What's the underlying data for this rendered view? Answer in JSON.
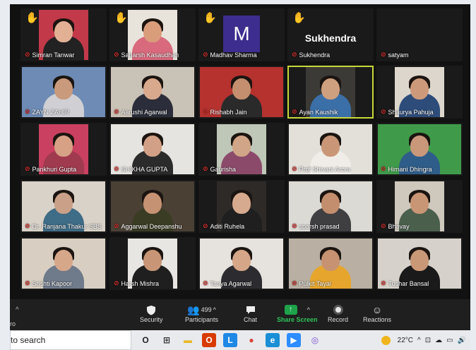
{
  "participants": [
    {
      "name": "Simran Tanwar",
      "hand": true,
      "bg": "#c23a4a",
      "skin": "#e2b095",
      "shirt": "#222"
    },
    {
      "name": "Saharsh Kasaudhan",
      "hand": true,
      "bg": "#e8e4dc",
      "skin": "#d99d7c",
      "shirt": "#d96a7d"
    },
    {
      "name": "Madhav Sharma",
      "hand": true,
      "avatar": "M"
    },
    {
      "name": "Sukhendra",
      "hand": true,
      "name_only": "Sukhendra"
    },
    {
      "name": "satyam",
      "hand": false,
      "empty": true
    },
    {
      "name": "ZAYN ZAHIR",
      "hand": false,
      "bg": "#6d8bb5",
      "skin": "#c99a7c",
      "shirt": "#cfcfd4",
      "full": true
    },
    {
      "name": "Aarushi Agarwal",
      "hand": false,
      "bg": "#c9c2b6",
      "skin": "#d8a98c",
      "shirt": "#2b2d3a",
      "full": true
    },
    {
      "name": "Rishabh Jain",
      "hand": false,
      "bg": "#b5322f",
      "skin": "#c48f6f",
      "shirt": "#2a2a2a",
      "full": true
    },
    {
      "name": "Ayan Kaushik",
      "hand": false,
      "bg": "#3c3a36",
      "skin": "#cfa07f",
      "shirt": "#3b6fa8",
      "active": true
    },
    {
      "name": "Shaurya Pahuja",
      "hand": false,
      "bg": "#dcd6cc",
      "skin": "#cc9a7a",
      "shirt": "#2d4c7a"
    },
    {
      "name": "Pankhuri Gupta",
      "hand": false,
      "bg": "#c94060",
      "skin": "#d6a185",
      "shirt": "#a03a4e"
    },
    {
      "name": "SHIKHA GUPTA",
      "hand": false,
      "bg": "#e6e4e0",
      "skin": "#d2a086",
      "shirt": "#2b2b2b",
      "full": true
    },
    {
      "name": "Gaurisha",
      "hand": false,
      "bg": "#bfc7b8",
      "skin": "#d1a587",
      "shirt": "#8c4a6a"
    },
    {
      "name": "Prof Shivani Arora",
      "hand": false,
      "bg": "#e3e0da",
      "skin": "#c99778",
      "shirt": "#f0ede8",
      "full": true
    },
    {
      "name": "Himani Dhingra",
      "hand": false,
      "bg": "#3f9b4a",
      "skin": "#c9987a",
      "shirt": "#2f5d8a",
      "full": true
    },
    {
      "name": "Dr. Ranjana Thakur SBS",
      "hand": false,
      "bg": "#d9d2c8",
      "skin": "#caa088",
      "shirt": "#3f6c86",
      "full": true
    },
    {
      "name": "Aggarwal Deepanshu",
      "hand": false,
      "bg": "#4a4034",
      "skin": "#c59273",
      "shirt": "#3a3c24",
      "full": true
    },
    {
      "name": "Aditi Ruhela",
      "hand": false,
      "bg": "#2e2a28",
      "skin": "#d6aa8e",
      "shirt": "#1f1f1f"
    },
    {
      "name": "sparsh prasad",
      "hand": false,
      "bg": "#dcdad5",
      "skin": "#c38e6d",
      "shirt": "#3f3f42",
      "full": true
    },
    {
      "name": "Bhavay",
      "hand": false,
      "bg": "#cfc8bd",
      "skin": "#c99675",
      "shirt": "#4b5f4d"
    },
    {
      "name": "Srishti Kapoor",
      "hand": false,
      "bg": "#d8cfc2",
      "skin": "#d7a78a",
      "shirt": "#6f7a8a",
      "full": true
    },
    {
      "name": "Harsh Mishra",
      "hand": false,
      "bg": "#e8e6e2",
      "skin": "#c89676",
      "shirt": "#1f1f1f"
    },
    {
      "name": "Tanya Agarwal",
      "hand": false,
      "bg": "#e6e2dd",
      "skin": "#d5a688",
      "shirt": "#2c2c30",
      "full": true
    },
    {
      "name": "Pulkit Tayal",
      "hand": false,
      "bg": "#b9b0a3",
      "skin": "#c79271",
      "shirt": "#e6a52c",
      "full": true
    },
    {
      "name": "Tushar Bansal",
      "hand": false,
      "bg": "#d6d2cb",
      "skin": "#c99877",
      "shirt": "#1a1a1a",
      "full": true
    }
  ],
  "toolbar": {
    "left_sliver": "ro",
    "security_label": "Security",
    "participants_label": "Participants",
    "participants_count": "499",
    "chat_label": "Chat",
    "share_label": "Share Screen",
    "record_label": "Record",
    "reactions_label": "Reactions"
  },
  "taskbar": {
    "search_text": "to search",
    "weather": "22°C",
    "apps": [
      {
        "name": "circle",
        "glyph": "O",
        "color": "#222",
        "bg": "transparent"
      },
      {
        "name": "task-view",
        "glyph": "⊞",
        "color": "#333",
        "bg": "transparent"
      },
      {
        "name": "file-explorer",
        "glyph": "▬",
        "color": "#e8b923",
        "bg": "transparent"
      },
      {
        "name": "office",
        "glyph": "O",
        "color": "#fff",
        "bg": "#d83b01"
      },
      {
        "name": "app-l",
        "glyph": "L",
        "color": "#fff",
        "bg": "#1e88e5"
      },
      {
        "name": "chrome",
        "glyph": "●",
        "color": "#db4437",
        "bg": "transparent"
      },
      {
        "name": "edge",
        "glyph": "e",
        "color": "#fff",
        "bg": "#1b8fd6"
      },
      {
        "name": "zoom",
        "glyph": "▶",
        "color": "#fff",
        "bg": "#2d8cff"
      },
      {
        "name": "app-purple",
        "glyph": "◎",
        "color": "#7b4fd1",
        "bg": "transparent"
      }
    ]
  }
}
